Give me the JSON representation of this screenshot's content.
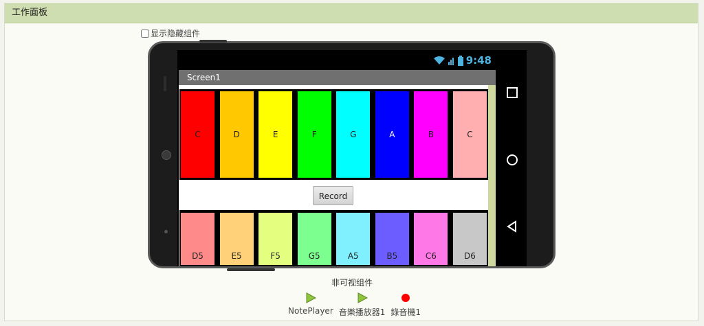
{
  "panel": {
    "title": "工作面板"
  },
  "toggle": {
    "label": "显示隐藏组件"
  },
  "status_bar": {
    "time": "9:48"
  },
  "screen": {
    "title": "Screen1"
  },
  "top_keys": [
    {
      "label": "C",
      "color": "#ff0000",
      "text_color": "#222"
    },
    {
      "label": "D",
      "color": "#ffc800",
      "text_color": "#222"
    },
    {
      "label": "E",
      "color": "#ffff00",
      "text_color": "#222"
    },
    {
      "label": "F",
      "color": "#00ff00",
      "text_color": "#222"
    },
    {
      "label": "G",
      "color": "#00ffff",
      "text_color": "#222"
    },
    {
      "label": "A",
      "color": "#0000ff",
      "text_color": "#ffffff"
    },
    {
      "label": "B",
      "color": "#ff00ff",
      "text_color": "#222"
    },
    {
      "label": "C",
      "color": "#ffafaf",
      "text_color": "#222"
    }
  ],
  "bottom_keys": [
    {
      "label": "D5",
      "color": "#ff8a8a",
      "text_color": "#222"
    },
    {
      "label": "E5",
      "color": "#ffd27a",
      "text_color": "#222"
    },
    {
      "label": "F5",
      "color": "#e4ff80",
      "text_color": "#222"
    },
    {
      "label": "G5",
      "color": "#7cff8f",
      "text_color": "#222"
    },
    {
      "label": "A5",
      "color": "#80f0ff",
      "text_color": "#222"
    },
    {
      "label": "B5",
      "color": "#6b5dff",
      "text_color": "#222"
    },
    {
      "label": "C6",
      "color": "#ff78e8",
      "text_color": "#222"
    },
    {
      "label": "D6",
      "color": "#c8c8c8",
      "text_color": "#222"
    }
  ],
  "record_button": {
    "label": "Record"
  },
  "nonvisible": {
    "title": "非可视组件",
    "items": [
      {
        "label": "NotePlayer",
        "icon": "player-icon"
      },
      {
        "label": "音樂播放器1",
        "icon": "player-icon"
      },
      {
        "label": "錄音機1",
        "icon": "recorder-icon"
      }
    ]
  }
}
